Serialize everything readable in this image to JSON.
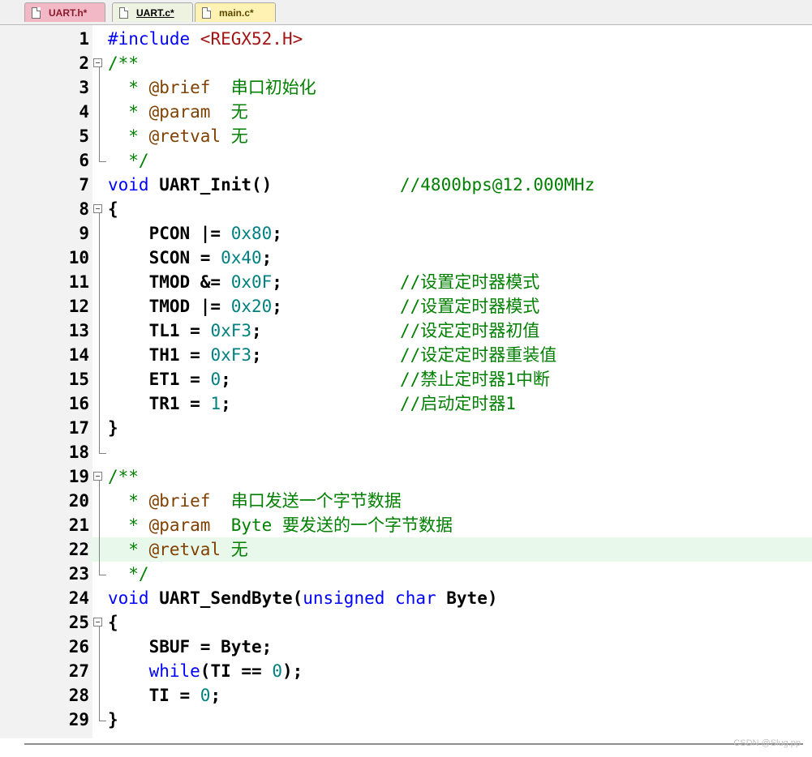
{
  "tabs": [
    {
      "label": "UART.h*"
    },
    {
      "label": "UART.c*"
    },
    {
      "label": "main.c*"
    }
  ],
  "colors": {
    "keyword": "#0000ff",
    "number": "#008080",
    "comment": "#008000",
    "doctag": "#804000",
    "include_path": "#a31515",
    "highlight_line": "#e8f8ea"
  },
  "lines": [
    {
      "num": "1",
      "parts": [
        {
          "t": "#include ",
          "c": "pp"
        },
        {
          "t": "<REGX52.H>",
          "c": "inc"
        }
      ]
    },
    {
      "num": "2",
      "fold": "open",
      "parts": [
        {
          "t": "/**",
          "c": "cm"
        }
      ]
    },
    {
      "num": "3",
      "parts": [
        {
          "t": "  * ",
          "c": "cm"
        },
        {
          "t": "@brief",
          "c": "tag"
        },
        {
          "t": "  串口初始化",
          "c": "cm"
        }
      ]
    },
    {
      "num": "4",
      "parts": [
        {
          "t": "  * ",
          "c": "cm"
        },
        {
          "t": "@param",
          "c": "tag"
        },
        {
          "t": "  无",
          "c": "cm"
        }
      ]
    },
    {
      "num": "5",
      "parts": [
        {
          "t": "  * ",
          "c": "cm"
        },
        {
          "t": "@retval",
          "c": "tag"
        },
        {
          "t": " 无",
          "c": "cm"
        }
      ]
    },
    {
      "num": "6",
      "fold": "end",
      "parts": [
        {
          "t": "  */",
          "c": "cm"
        }
      ]
    },
    {
      "num": "7",
      "parts": [
        {
          "t": "void",
          "c": "kw"
        },
        {
          "t": " UART_Init()",
          "c": "bold"
        }
      ],
      "comment": "//4800bps@12.000MHz"
    },
    {
      "num": "8",
      "fold": "open",
      "parts": [
        {
          "t": "{",
          "c": "bold"
        }
      ]
    },
    {
      "num": "9",
      "parts": [
        {
          "t": "    PCON |= ",
          "c": "bold"
        },
        {
          "t": "0x80",
          "c": "num"
        },
        {
          "t": ";",
          "c": "bold"
        }
      ]
    },
    {
      "num": "10",
      "parts": [
        {
          "t": "    SCON = ",
          "c": "bold"
        },
        {
          "t": "0x40",
          "c": "num"
        },
        {
          "t": ";",
          "c": "bold"
        }
      ]
    },
    {
      "num": "11",
      "parts": [
        {
          "t": "    TMOD &= ",
          "c": "bold"
        },
        {
          "t": "0x0F",
          "c": "num"
        },
        {
          "t": ";",
          "c": "bold"
        }
      ],
      "comment": "//设置定时器模式"
    },
    {
      "num": "12",
      "parts": [
        {
          "t": "    TMOD |= ",
          "c": "bold"
        },
        {
          "t": "0x20",
          "c": "num"
        },
        {
          "t": ";",
          "c": "bold"
        }
      ],
      "comment": "//设置定时器模式"
    },
    {
      "num": "13",
      "parts": [
        {
          "t": "    TL1 = ",
          "c": "bold"
        },
        {
          "t": "0xF3",
          "c": "num"
        },
        {
          "t": ";",
          "c": "bold"
        }
      ],
      "comment": "//设定定时器初值"
    },
    {
      "num": "14",
      "parts": [
        {
          "t": "    TH1 = ",
          "c": "bold"
        },
        {
          "t": "0xF3",
          "c": "num"
        },
        {
          "t": ";",
          "c": "bold"
        }
      ],
      "comment": "//设定定时器重装值"
    },
    {
      "num": "15",
      "parts": [
        {
          "t": "    ET1 = ",
          "c": "bold"
        },
        {
          "t": "0",
          "c": "num"
        },
        {
          "t": ";",
          "c": "bold"
        }
      ],
      "comment": "//禁止定时器1中断"
    },
    {
      "num": "16",
      "parts": [
        {
          "t": "    TR1 = ",
          "c": "bold"
        },
        {
          "t": "1",
          "c": "num"
        },
        {
          "t": ";",
          "c": "bold"
        }
      ],
      "comment": "//启动定时器1"
    },
    {
      "num": "17",
      "parts": [
        {
          "t": "}",
          "c": "bold"
        }
      ]
    },
    {
      "num": "18",
      "fold": "end",
      "parts": []
    },
    {
      "num": "19",
      "fold": "open",
      "parts": [
        {
          "t": "/**",
          "c": "cm"
        }
      ]
    },
    {
      "num": "20",
      "parts": [
        {
          "t": "  * ",
          "c": "cm"
        },
        {
          "t": "@brief",
          "c": "tag"
        },
        {
          "t": "  串口发送一个字节数据",
          "c": "cm"
        }
      ]
    },
    {
      "num": "21",
      "parts": [
        {
          "t": "  * ",
          "c": "cm"
        },
        {
          "t": "@param",
          "c": "tag"
        },
        {
          "t": "  Byte ",
          "c": "cm"
        },
        {
          "t": "要发送的一个字节数据",
          "c": "cm"
        }
      ]
    },
    {
      "num": "22",
      "highlight": true,
      "parts": [
        {
          "t": "  * ",
          "c": "cm"
        },
        {
          "t": "@retval",
          "c": "tag"
        },
        {
          "t": " 无",
          "c": "cm"
        }
      ]
    },
    {
      "num": "23",
      "fold": "end",
      "parts": [
        {
          "t": "  */",
          "c": "cm"
        }
      ]
    },
    {
      "num": "24",
      "parts": [
        {
          "t": "void",
          "c": "kw"
        },
        {
          "t": " UART_SendByte(",
          "c": "bold"
        },
        {
          "t": "unsigned",
          "c": "kw"
        },
        {
          "t": " ",
          "c": "bold"
        },
        {
          "t": "char",
          "c": "kw"
        },
        {
          "t": " Byte)",
          "c": "bold"
        }
      ]
    },
    {
      "num": "25",
      "fold": "open",
      "parts": [
        {
          "t": "{",
          "c": "bold"
        }
      ]
    },
    {
      "num": "26",
      "parts": [
        {
          "t": "    SBUF = Byte;",
          "c": "bold"
        }
      ]
    },
    {
      "num": "27",
      "parts": [
        {
          "t": "    ",
          "c": "bold"
        },
        {
          "t": "while",
          "c": "kw"
        },
        {
          "t": "(TI == ",
          "c": "bold"
        },
        {
          "t": "0",
          "c": "num"
        },
        {
          "t": ");",
          "c": "bold"
        }
      ]
    },
    {
      "num": "28",
      "parts": [
        {
          "t": "    TI = ",
          "c": "bold"
        },
        {
          "t": "0",
          "c": "num"
        },
        {
          "t": ";",
          "c": "bold"
        }
      ]
    },
    {
      "num": "29",
      "fold": "end",
      "parts": [
        {
          "t": "}",
          "c": "bold"
        }
      ]
    }
  ],
  "watermark": "CSDN @Slug.pp"
}
